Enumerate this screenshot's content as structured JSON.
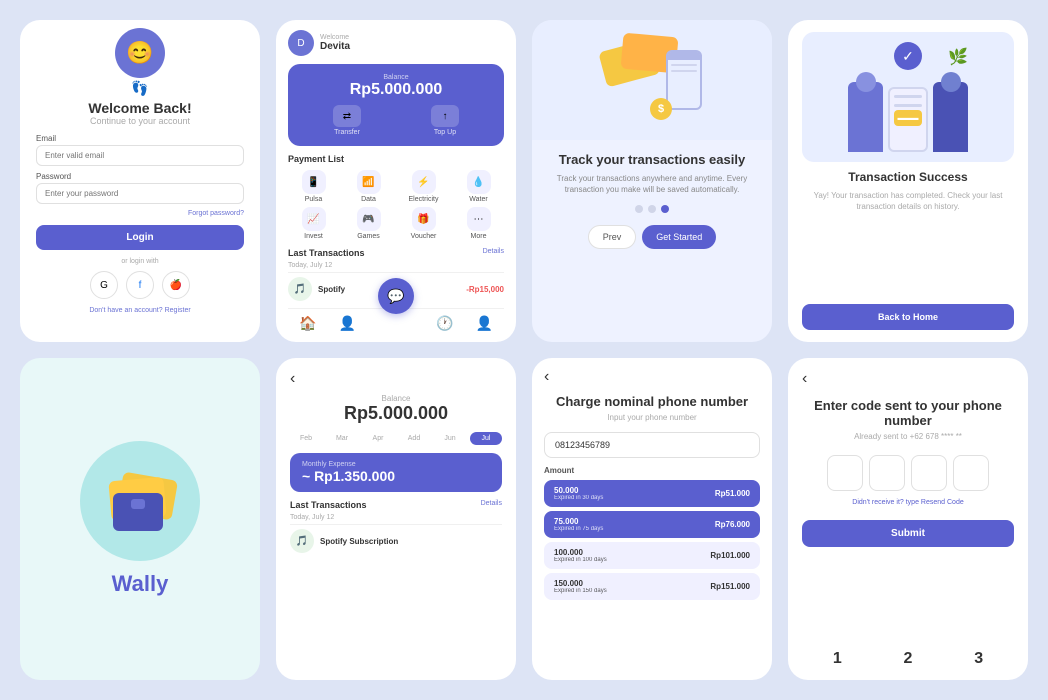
{
  "app": {
    "background": "#dde4f5"
  },
  "login": {
    "title": "Welcome Back!",
    "subtitle": "Continue to your account",
    "email_label": "Email",
    "email_placeholder": "Enter valid email",
    "password_label": "Password",
    "password_placeholder": "Enter your password",
    "forgot_password": "Forgot password?",
    "login_button": "Login",
    "or_login": "or login with",
    "register_text": "Don't have an account?",
    "register_link": "Register"
  },
  "dashboard": {
    "welcome": "Welcome",
    "user_name": "Devita",
    "balance_label": "Balance",
    "balance_amount": "Rp5.000.000",
    "transfer_label": "Transfer",
    "topup_label": "Top Up",
    "payment_list_title": "Payment List",
    "payment_items": [
      {
        "label": "Pulsa",
        "icon": "📱"
      },
      {
        "label": "Data",
        "icon": "📶"
      },
      {
        "label": "Electricity",
        "icon": "⚡"
      },
      {
        "label": "Water",
        "icon": "💧"
      },
      {
        "label": "Invest",
        "icon": "📈"
      },
      {
        "label": "Games",
        "icon": "🎮"
      },
      {
        "label": "Voucher",
        "icon": "🎁"
      },
      {
        "label": "More",
        "icon": "⋯"
      }
    ],
    "last_transactions": "Last Transactions",
    "details": "Details",
    "transaction_date": "Today, July 12",
    "transaction_name": "Spotify",
    "transaction_amount": "-Rp15,000"
  },
  "track": {
    "title": "Track your transactions easily",
    "description": "Track your transactions anywhere and anytime. Every transaction you make will be saved automatically.",
    "prev_button": "Prev",
    "next_button": "Get Started",
    "active_dot": 2
  },
  "success": {
    "title": "Transaction Success",
    "description": "Yay! Your transaction has completed. Check your last transaction details on history.",
    "button": "Back to Home",
    "back_arrow": "‹"
  },
  "wally": {
    "title": "Wally"
  },
  "chart": {
    "balance_label": "Balance",
    "balance_amount": "Rp5.000.000",
    "months": [
      "Feb",
      "Mar",
      "Apr",
      "Add",
      "Jun",
      "Jul"
    ],
    "active_month": "Jul",
    "expense_label": "Monthly Expense",
    "expense_amount": "~ Rp1.350.000",
    "last_transactions": "Last Transactions",
    "details": "Details",
    "transaction_date": "Today, July 12",
    "transaction_name": "Spotify Subscription",
    "back_arrow": "‹"
  },
  "phone_charge": {
    "back_arrow": "‹",
    "title": "Charge nominal phone number",
    "subtitle": "Input your phone number",
    "phone_number": "08123456789",
    "amount_label": "Amount",
    "amounts": [
      {
        "value": "50.000",
        "expire": "Expired in 30 days",
        "price": "Rp51.000",
        "active": true
      },
      {
        "value": "75.000",
        "expire": "Expired in 75 days",
        "price": "Rp76.000",
        "active": true
      },
      {
        "value": "100.000",
        "expire": "Expired in 100 days",
        "price": "Rp101.000",
        "active": false
      },
      {
        "value": "150.000",
        "expire": "Expired in 150 days",
        "price": "Rp151.000",
        "active": false
      }
    ]
  },
  "enter_code": {
    "back_arrow": "‹",
    "title": "Enter code sent to your phone number",
    "subtitle": "Already sent to +62 678 **** **",
    "resend_text": "Didn't receive it? type",
    "resend_link": "Resend Code",
    "submit_button": "Submit",
    "numpad": [
      "1",
      "2",
      "3"
    ]
  }
}
